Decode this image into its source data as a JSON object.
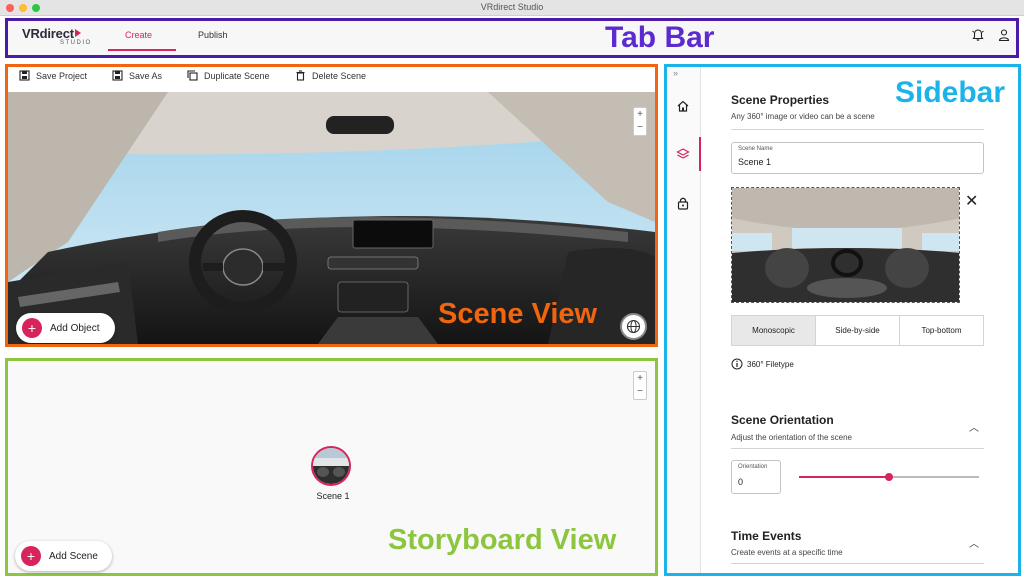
{
  "window": {
    "title": "VRdirect Studio"
  },
  "tabbar": {
    "logo_main": "VRdirect",
    "logo_sub": "STUDIO",
    "tabs": [
      {
        "label": "Create"
      },
      {
        "label": "Publish"
      }
    ],
    "active_tab": "Create",
    "overlay_label": "Tab Bar",
    "icons": [
      "bell-icon",
      "user-icon"
    ]
  },
  "scene_toolbar": {
    "items": [
      {
        "label": "Save Project",
        "icon": "save-icon"
      },
      {
        "label": "Save As",
        "icon": "save-as-icon"
      },
      {
        "label": "Duplicate Scene",
        "icon": "duplicate-icon"
      },
      {
        "label": "Delete Scene",
        "icon": "trash-icon"
      }
    ]
  },
  "scene_view": {
    "add_object_label": "Add Object",
    "overlay_label": "Scene View",
    "zoom_in": "+",
    "zoom_out": "−"
  },
  "storyboard": {
    "scene_node_label": "Scene 1",
    "add_scene_label": "Add Scene",
    "overlay_label": "Storyboard View",
    "zoom_in": "+",
    "zoom_out": "−"
  },
  "sidebar": {
    "overlay_label": "Sidebar",
    "collapse_glyph": "»",
    "rail_icons": [
      "home-icon",
      "layers-icon",
      "lock-icon"
    ],
    "scene_properties": {
      "title": "Scene Properties",
      "subtitle": "Any 360° image or video can be a scene",
      "name_label": "Scene Name",
      "name_value": "Scene 1"
    },
    "filetype": {
      "options": [
        "Monoscopic",
        "Side-by-side",
        "Top-bottom"
      ],
      "selected": "Monoscopic",
      "info_label": "360° Filetype"
    },
    "orientation": {
      "title": "Scene Orientation",
      "subtitle": "Adjust the orientation of the scene",
      "field_label": "Orientation",
      "field_value": "0",
      "slider_fraction": 0.5
    },
    "time_events": {
      "title": "Time Events",
      "subtitle": "Create events at a specific time"
    }
  },
  "colors": {
    "accent": "#d7245c",
    "tabbar_outline": "#4a1aa8",
    "scene_outline": "#f0650f",
    "storyboard_outline": "#8cc63f",
    "sidebar_outline": "#1ab3ea"
  }
}
